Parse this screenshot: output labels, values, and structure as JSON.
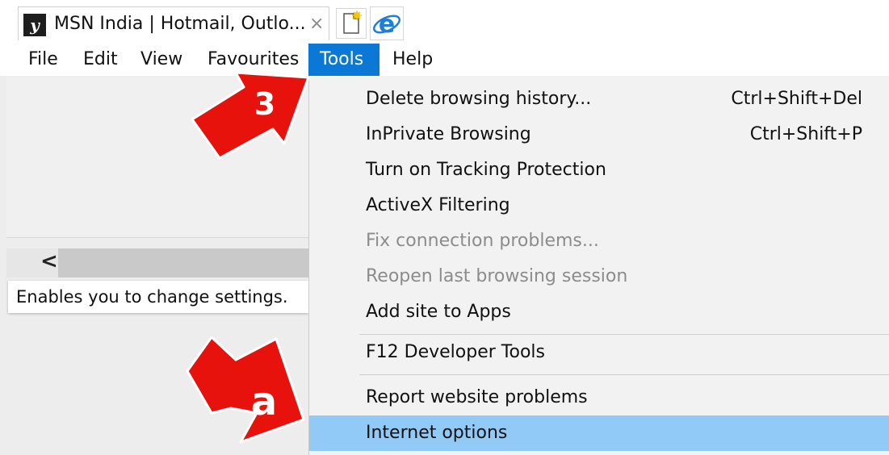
{
  "tab": {
    "title": "MSN India | Hotmail, Outlo...",
    "close_glyph": "×",
    "favicon_icon": "msn-logo-icon",
    "favicon_glyph": "y"
  },
  "menubar": {
    "items": [
      {
        "label": "File"
      },
      {
        "label": "Edit"
      },
      {
        "label": "View"
      },
      {
        "label": "Favourites"
      },
      {
        "label": "Tools"
      },
      {
        "label": "Help"
      }
    ]
  },
  "tools_menu": {
    "items": [
      {
        "label": "Delete browsing history...",
        "shortcut": "Ctrl+Shift+Del"
      },
      {
        "label": "InPrivate Browsing",
        "shortcut": "Ctrl+Shift+P"
      },
      {
        "label": "Turn on Tracking Protection",
        "shortcut": ""
      },
      {
        "label": "ActiveX Filtering",
        "shortcut": ""
      },
      {
        "label": "Fix connection problems...",
        "shortcut": ""
      },
      {
        "label": "Reopen last browsing session",
        "shortcut": ""
      },
      {
        "label": "Add site to Apps",
        "shortcut": ""
      },
      {
        "label": "F12 Developer Tools",
        "shortcut": ""
      },
      {
        "label": "Report website problems",
        "shortcut": ""
      },
      {
        "label": "Internet options",
        "shortcut": ""
      }
    ]
  },
  "status_bar": {
    "text": "Enables you to change settings."
  },
  "scrollbar": {
    "left_glyph": "<"
  },
  "annotations": {
    "arrow_3_label": "3",
    "arrow_a_label": "a",
    "arrow_color": "#e8120c"
  },
  "colors": {
    "menu_active": "#0a78d4",
    "menu_highlight": "#91c9f7",
    "menu_background": "#f2f2f2",
    "disabled_text": "#8c8c8c"
  }
}
